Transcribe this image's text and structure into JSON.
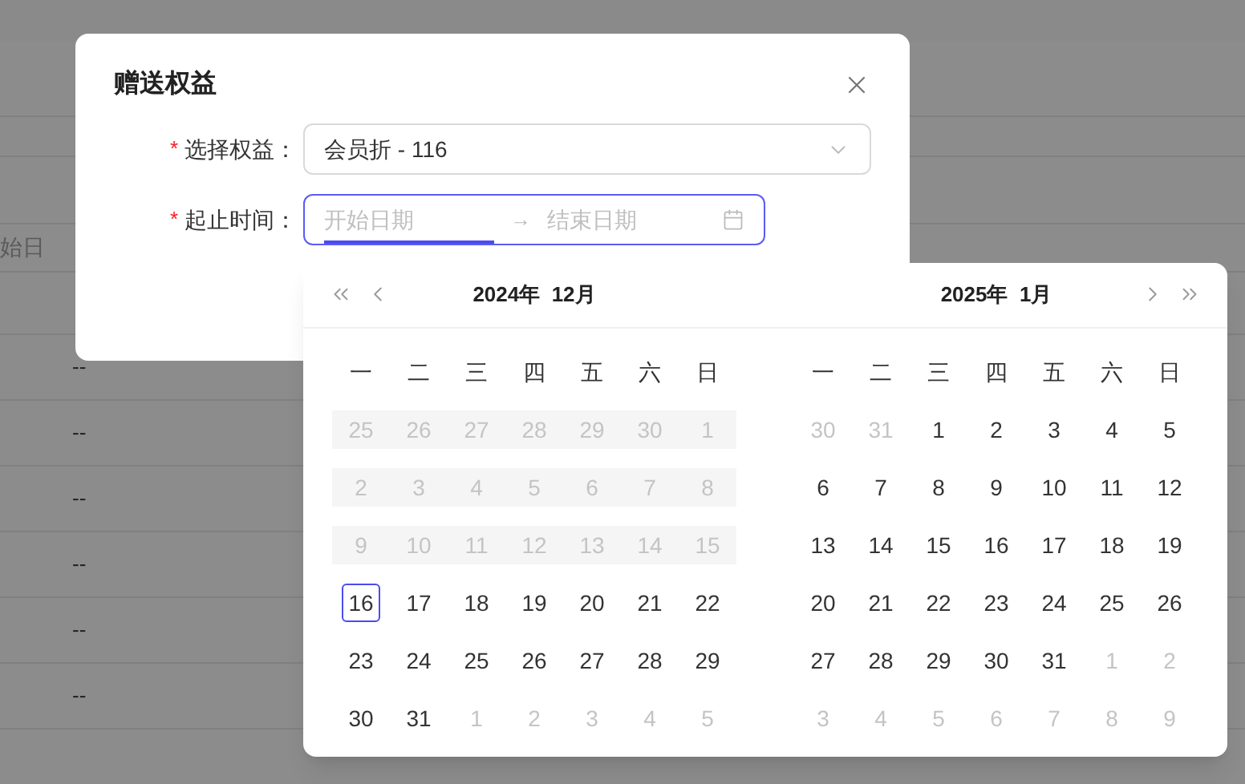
{
  "background": {
    "filter_placeholder": "始日",
    "rows": [
      "--",
      "--",
      "--",
      "--",
      "--",
      "--"
    ]
  },
  "dialog": {
    "title": "赠送权益",
    "fields": [
      {
        "kind": "select",
        "label": "选择权益：",
        "required_mark": "*",
        "value": "会员折 - 116"
      },
      {
        "kind": "range",
        "label": "起止时间：",
        "required_mark": "*",
        "start_placeholder": "开始日期",
        "end_placeholder": "结束日期",
        "separator": "→"
      }
    ]
  },
  "calendar": {
    "panels": [
      {
        "title": "2024年  12月",
        "weekdays": [
          "一",
          "二",
          "三",
          "四",
          "五",
          "六",
          "日"
        ],
        "weeks": [
          [
            {
              "day": "25",
              "kind": "disabled"
            },
            {
              "day": "26",
              "kind": "disabled"
            },
            {
              "day": "27",
              "kind": "disabled"
            },
            {
              "day": "28",
              "kind": "disabled"
            },
            {
              "day": "29",
              "kind": "disabled"
            },
            {
              "day": "30",
              "kind": "disabled"
            },
            {
              "day": "1",
              "kind": "disabled"
            }
          ],
          [
            {
              "day": "2",
              "kind": "disabled"
            },
            {
              "day": "3",
              "kind": "disabled"
            },
            {
              "day": "4",
              "kind": "disabled"
            },
            {
              "day": "5",
              "kind": "disabled"
            },
            {
              "day": "6",
              "kind": "disabled"
            },
            {
              "day": "7",
              "kind": "disabled"
            },
            {
              "day": "8",
              "kind": "disabled"
            }
          ],
          [
            {
              "day": "9",
              "kind": "disabled"
            },
            {
              "day": "10",
              "kind": "disabled"
            },
            {
              "day": "11",
              "kind": "disabled"
            },
            {
              "day": "12",
              "kind": "disabled"
            },
            {
              "day": "13",
              "kind": "disabled"
            },
            {
              "day": "14",
              "kind": "disabled"
            },
            {
              "day": "15",
              "kind": "disabled"
            }
          ],
          [
            {
              "day": "16",
              "kind": "today"
            },
            {
              "day": "17",
              "kind": "day"
            },
            {
              "day": "18",
              "kind": "day"
            },
            {
              "day": "19",
              "kind": "day"
            },
            {
              "day": "20",
              "kind": "day"
            },
            {
              "day": "21",
              "kind": "day"
            },
            {
              "day": "22",
              "kind": "day"
            }
          ],
          [
            {
              "day": "23",
              "kind": "day"
            },
            {
              "day": "24",
              "kind": "day"
            },
            {
              "day": "25",
              "kind": "day"
            },
            {
              "day": "26",
              "kind": "day"
            },
            {
              "day": "27",
              "kind": "day"
            },
            {
              "day": "28",
              "kind": "day"
            },
            {
              "day": "29",
              "kind": "day"
            }
          ],
          [
            {
              "day": "30",
              "kind": "day"
            },
            {
              "day": "31",
              "kind": "day"
            },
            {
              "day": "1",
              "kind": "outside"
            },
            {
              "day": "2",
              "kind": "outside"
            },
            {
              "day": "3",
              "kind": "outside"
            },
            {
              "day": "4",
              "kind": "outside"
            },
            {
              "day": "5",
              "kind": "outside"
            }
          ]
        ]
      },
      {
        "title": "2025年  1月",
        "weekdays": [
          "一",
          "二",
          "三",
          "四",
          "五",
          "六",
          "日"
        ],
        "weeks": [
          [
            {
              "day": "30",
              "kind": "outside"
            },
            {
              "day": "31",
              "kind": "outside"
            },
            {
              "day": "1",
              "kind": "day"
            },
            {
              "day": "2",
              "kind": "day"
            },
            {
              "day": "3",
              "kind": "day"
            },
            {
              "day": "4",
              "kind": "day"
            },
            {
              "day": "5",
              "kind": "day"
            }
          ],
          [
            {
              "day": "6",
              "kind": "day"
            },
            {
              "day": "7",
              "kind": "day"
            },
            {
              "day": "8",
              "kind": "day"
            },
            {
              "day": "9",
              "kind": "day"
            },
            {
              "day": "10",
              "kind": "day"
            },
            {
              "day": "11",
              "kind": "day"
            },
            {
              "day": "12",
              "kind": "day"
            }
          ],
          [
            {
              "day": "13",
              "kind": "day"
            },
            {
              "day": "14",
              "kind": "day"
            },
            {
              "day": "15",
              "kind": "day"
            },
            {
              "day": "16",
              "kind": "day"
            },
            {
              "day": "17",
              "kind": "day"
            },
            {
              "day": "18",
              "kind": "day"
            },
            {
              "day": "19",
              "kind": "day"
            }
          ],
          [
            {
              "day": "20",
              "kind": "day"
            },
            {
              "day": "21",
              "kind": "day"
            },
            {
              "day": "22",
              "kind": "day"
            },
            {
              "day": "23",
              "kind": "day"
            },
            {
              "day": "24",
              "kind": "day"
            },
            {
              "day": "25",
              "kind": "day"
            },
            {
              "day": "26",
              "kind": "day"
            }
          ],
          [
            {
              "day": "27",
              "kind": "day"
            },
            {
              "day": "28",
              "kind": "day"
            },
            {
              "day": "29",
              "kind": "day"
            },
            {
              "day": "30",
              "kind": "day"
            },
            {
              "day": "31",
              "kind": "day"
            },
            {
              "day": "1",
              "kind": "outside"
            },
            {
              "day": "2",
              "kind": "outside"
            }
          ],
          [
            {
              "day": "3",
              "kind": "outside"
            },
            {
              "day": "4",
              "kind": "outside"
            },
            {
              "day": "5",
              "kind": "outside"
            },
            {
              "day": "6",
              "kind": "outside"
            },
            {
              "day": "7",
              "kind": "outside"
            },
            {
              "day": "8",
              "kind": "outside"
            },
            {
              "day": "9",
              "kind": "outside"
            }
          ]
        ]
      }
    ]
  }
}
